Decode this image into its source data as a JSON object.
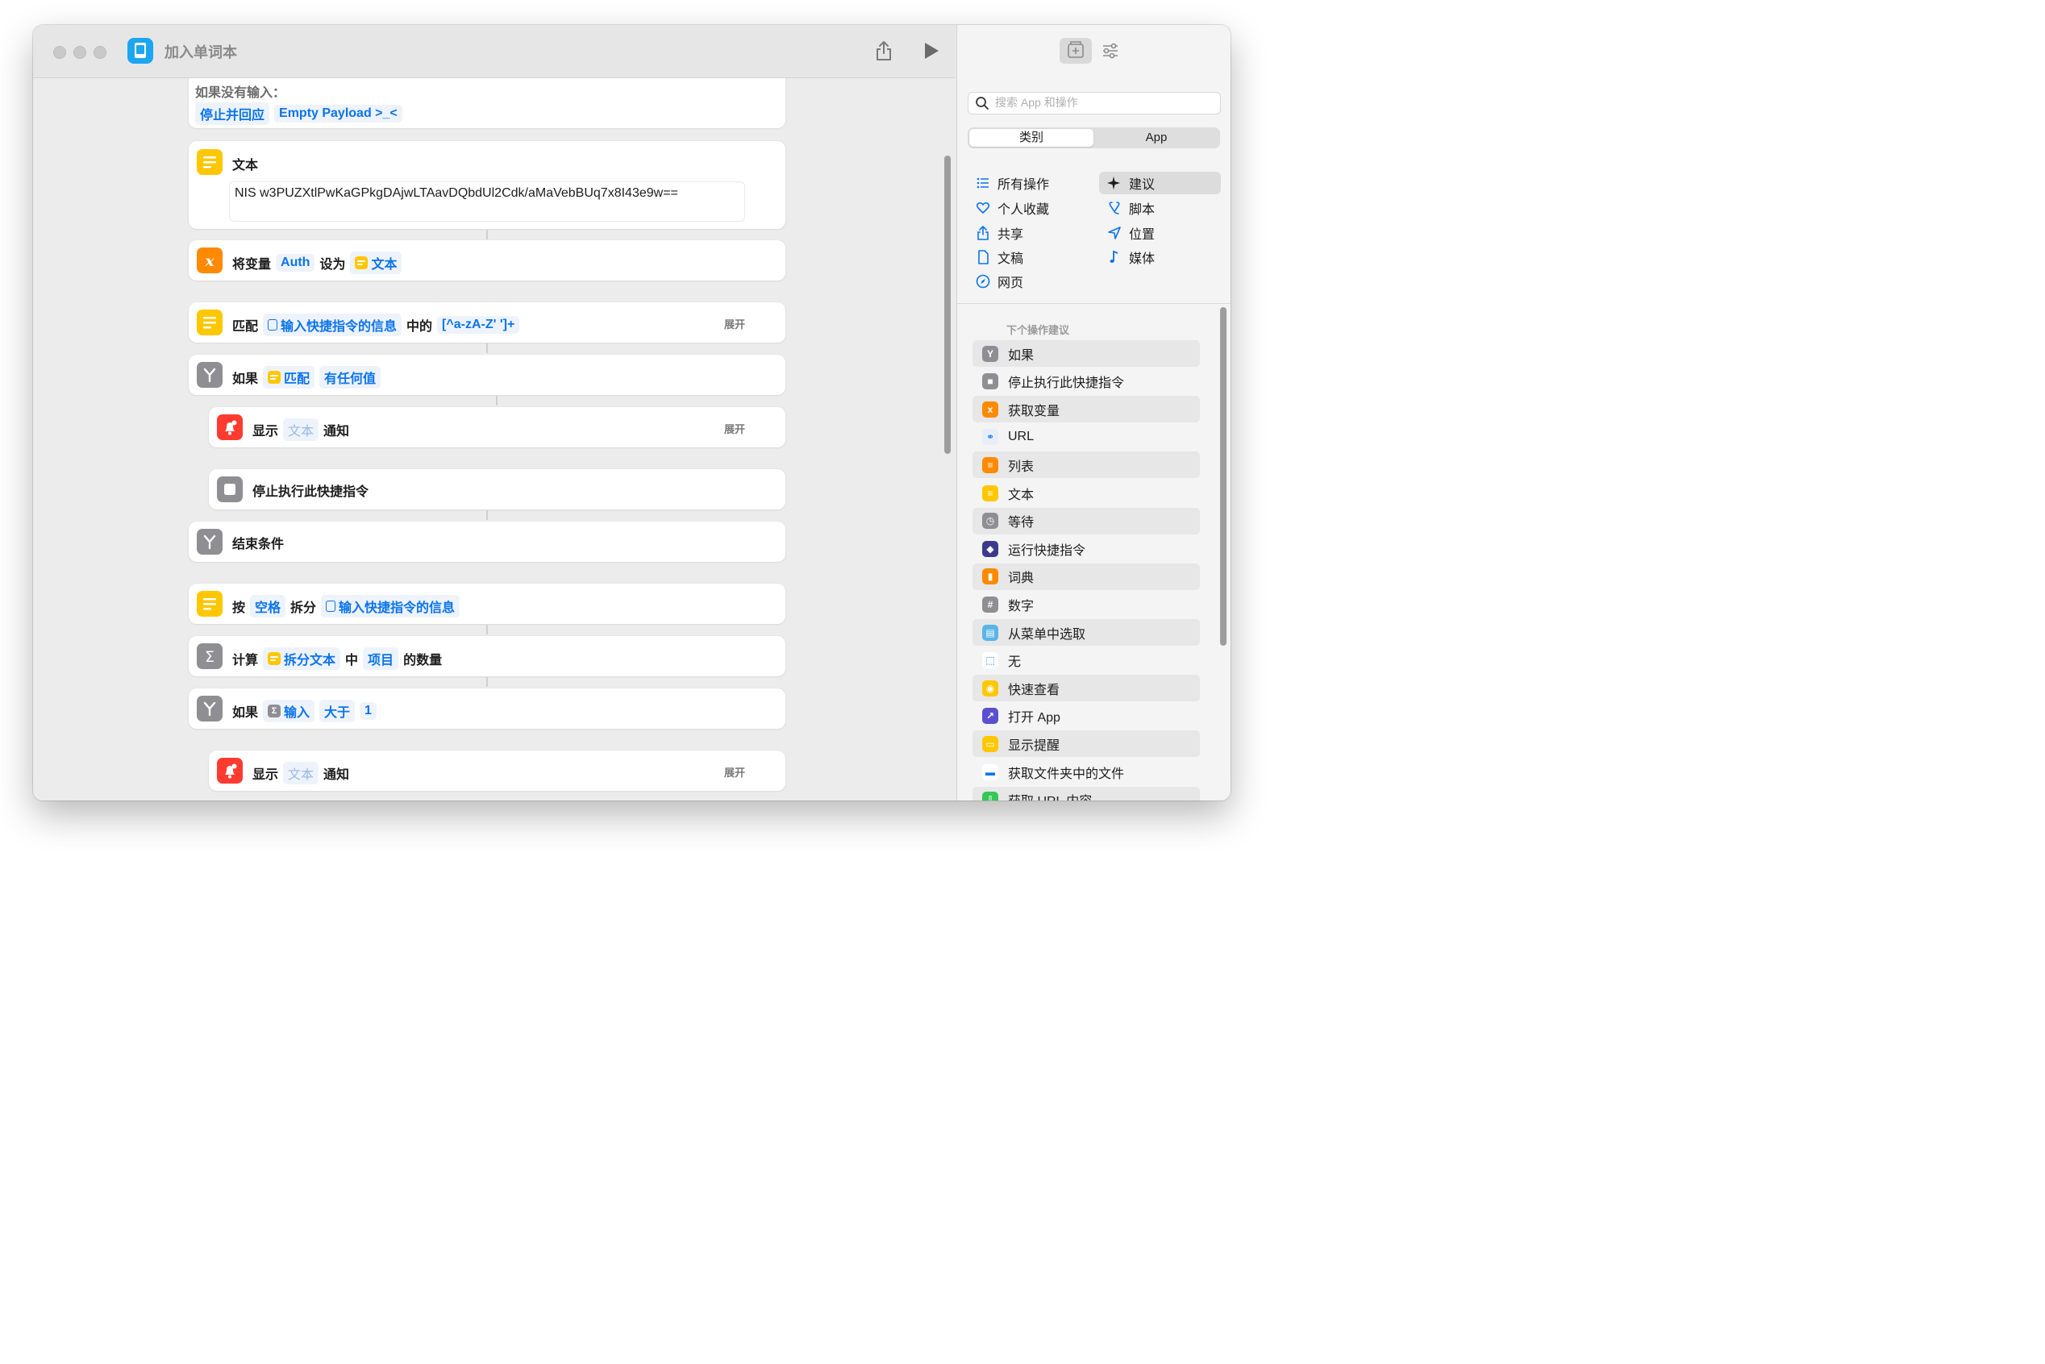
{
  "window": {
    "title": "加入单词本"
  },
  "actions": {
    "top": {
      "label": "如果没有输入：",
      "action": "停止并回应",
      "payload": "Empty Payload >_<"
    },
    "text": {
      "title": "文本",
      "content": "NIS w3PUZXtlPwKaGPkgDAjwLTAavDQbdUl2Cdk/aMaVebBUq7x8I43e9w=="
    },
    "setvar": {
      "label": "将变量",
      "name": "Auth",
      "mid": "设为",
      "value": "文本"
    },
    "match": {
      "label": "匹配",
      "input": "输入快捷指令的信息",
      "mid": "中的",
      "pattern": "[^a-zA-Z' ']+",
      "expand": "展开"
    },
    "if1": {
      "label": "如果",
      "var": "匹配",
      "cond": "有任何值"
    },
    "notify1": {
      "label": "显示",
      "placeholder": "文本",
      "suffix": "通知",
      "expand": "展开"
    },
    "stop": {
      "label": "停止执行此快捷指令"
    },
    "endif": {
      "label": "结束条件"
    },
    "split": {
      "label": "按",
      "sep": "空格",
      "mid": "拆分",
      "input": "输入快捷指令的信息"
    },
    "count": {
      "label": "计算",
      "var": "拆分文本",
      "mid": "中",
      "unit": "项目",
      "suffix": "的数量"
    },
    "if2": {
      "label": "如果",
      "var": "输入",
      "cond": "大于",
      "value": "1"
    },
    "notify2": {
      "label": "显示",
      "placeholder": "文本",
      "suffix": "通知",
      "expand": "展开"
    }
  },
  "sidebar": {
    "search_placeholder": "搜索 App 和操作",
    "segments": [
      "类别",
      "App"
    ],
    "categories_left": [
      "所有操作",
      "个人收藏",
      "共享",
      "文稿",
      "网页"
    ],
    "categories_right": [
      "建议",
      "脚本",
      "位置",
      "媒体"
    ],
    "suggest_title": "下个操作建议",
    "suggestions": [
      "如果",
      "停止执行此快捷指令",
      "获取变量",
      "URL",
      "列表",
      "文本",
      "等待",
      "运行快捷指令",
      "词典",
      "数字",
      "从菜单中选取",
      "无",
      "快速查看",
      "打开 App",
      "显示提醒",
      "获取文件夹中的文件",
      "获取 URL 内容"
    ],
    "suggestion_icons": [
      "if-icon",
      "stop-icon",
      "variable-icon",
      "link-icon",
      "list-icon",
      "text-icon",
      "wait-icon",
      "shortcuts-icon",
      "dictionary-icon",
      "number-icon",
      "menu-icon",
      "nothing-icon",
      "quicklook-icon",
      "open-app-icon",
      "alert-icon",
      "folder-icon",
      "download-icon"
    ]
  },
  "colors": {
    "accent": "#0a74ee",
    "text_action": "#ffc700",
    "variable": "#ff8a00",
    "scripting": "#8e8e93",
    "notification": "#ff3b30"
  }
}
